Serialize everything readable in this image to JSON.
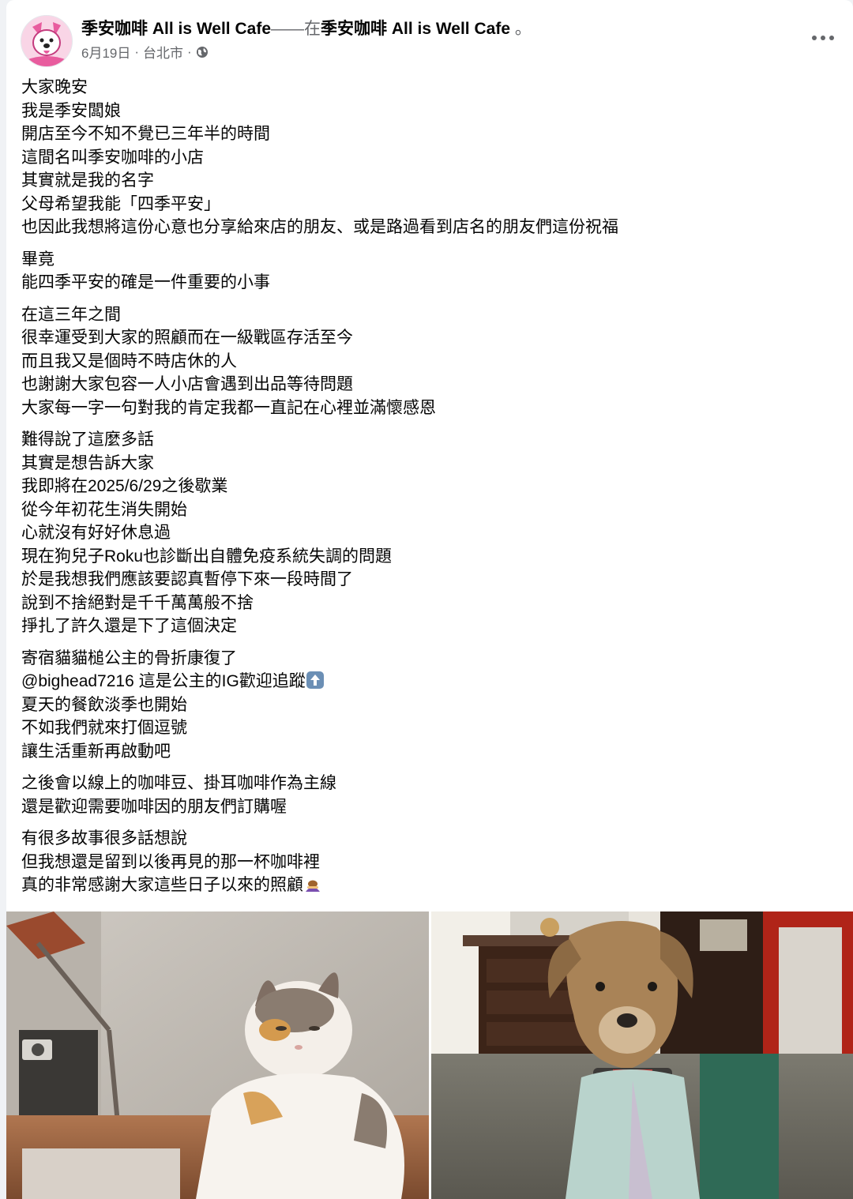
{
  "post": {
    "author": "季安咖啡 All is Well Cafe",
    "connector": "——在",
    "location_page": "季安咖啡 All is Well Cafe",
    "suffix": " 。",
    "date": "6月19日",
    "dot1": "·",
    "place": "台北市",
    "dot2": "·",
    "privacy_icon": "globe-icon",
    "more_icon": "more-options-icon"
  },
  "body": {
    "p1": [
      "大家晚安",
      "我是季安闆娘",
      "開店至今不知不覺已三年半的時間",
      "這間名叫季安咖啡的小店",
      "其實就是我的名字",
      "父母希望我能「四季平安」",
      "也因此我想將這份心意也分享給來店的朋友、或是路過看到店名的朋友們這份祝福"
    ],
    "p2": [
      "畢竟",
      "能四季平安的確是一件重要的小事"
    ],
    "p3": [
      "在這三年之間",
      "很幸運受到大家的照顧而在一級戰區存活至今",
      "而且我又是個時不時店休的人",
      "也謝謝大家包容一人小店會遇到出品等待問題",
      "大家每一字一句對我的肯定我都一直記在心裡並滿懷感恩"
    ],
    "p4": [
      "難得說了這麼多話",
      "其實是想告訴大家",
      "我即將在2025/6/29之後歇業",
      "從今年初花生消失開始",
      "心就沒有好好休息過",
      "現在狗兒子Roku也診斷出自體免疫系統失調的問題",
      "於是我想我們應該要認真暫停下來一段時間了",
      "說到不捨絕對是千千萬萬般不捨",
      "掙扎了許久還是下了這個決定"
    ],
    "p5": [
      "寄宿貓貓槌公主的骨折康復了",
      "@bighead7216 這是公主的IG歡迎追蹤",
      "夏天的餐飲淡季也開始",
      "不如我們就來打個逗號",
      "讓生活重新再啟動吧"
    ],
    "p6": [
      "之後會以線上的咖啡豆、掛耳咖啡作為主線",
      "還是歡迎需要咖啡因的朋友們訂購喔"
    ],
    "p7": [
      "有很多故事很多話想說",
      "但我想還是留到以後再見的那一杯咖啡裡",
      "真的非常感謝大家這些日子以來的照顧"
    ],
    "emoji_up": "up-arrow-emoji-icon",
    "emoji_bow": "bowing-person-emoji-icon"
  },
  "photos": [
    {
      "name": "calico-cat-photo"
    },
    {
      "name": "dog-photo"
    }
  ],
  "colors": {
    "text": "#050505",
    "muted": "#65676b",
    "background": "#f0f2f5",
    "card": "#ffffff",
    "emoji_blue": "#6b8fb5"
  }
}
